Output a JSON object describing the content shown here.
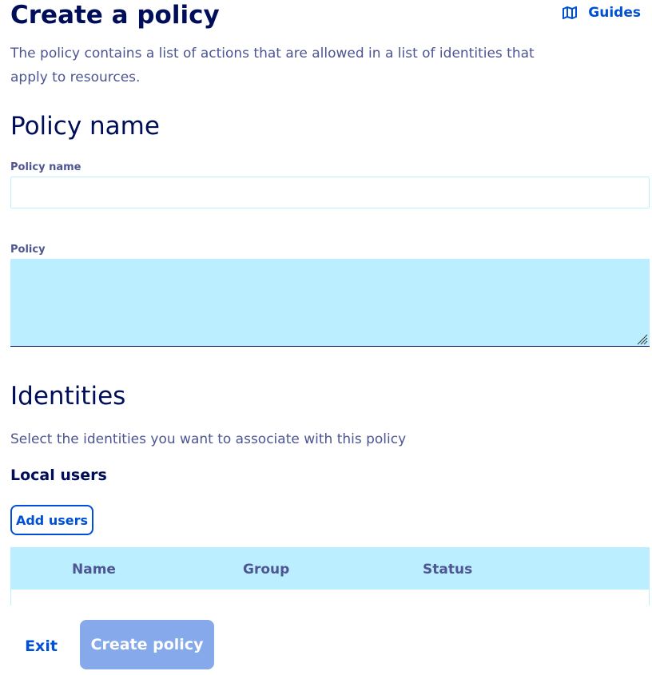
{
  "header": {
    "title": "Create a policy",
    "guides_label": "Guides"
  },
  "intro": "The policy contains a list of actions that are allowed in a list of identities that apply to resources.",
  "policy_section": {
    "heading": "Policy name",
    "name_label": "Policy name",
    "name_value": "",
    "policy_label": "Policy",
    "policy_value": ""
  },
  "identities": {
    "heading": "Identities",
    "description": "Select the identities you want to associate with this policy",
    "local_users_heading": "Local users",
    "add_users_label": "Add users",
    "table_columns": [
      "Name",
      "Group",
      "Status"
    ]
  },
  "footer": {
    "exit_label": "Exit",
    "create_label": "Create policy"
  },
  "colors": {
    "primary": "#0050d7",
    "heading": "#000e5a",
    "text": "#4d5592",
    "light_blue": "#bbefff",
    "disabled_button": "#85a9ea"
  },
  "icons": {
    "guides": "book-icon",
    "resize": "resize-grip-icon"
  }
}
